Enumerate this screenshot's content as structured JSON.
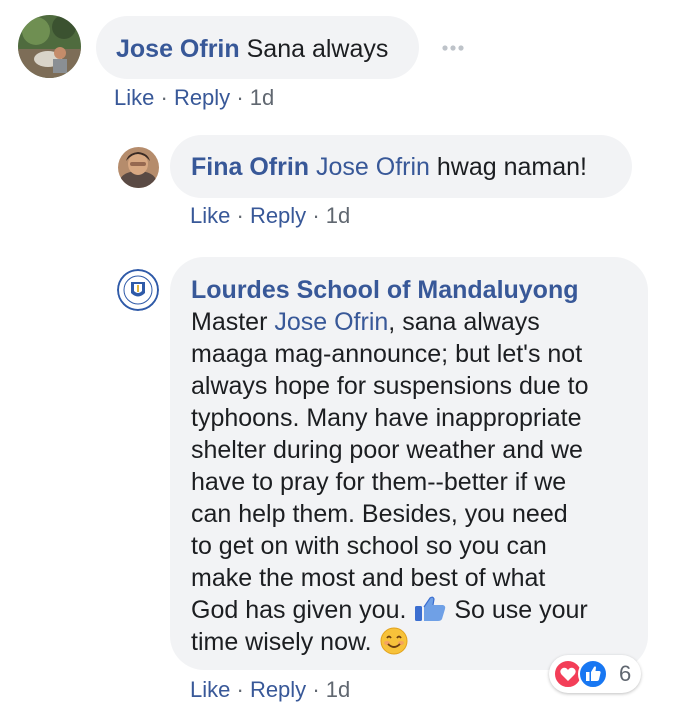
{
  "comments": [
    {
      "author": "Jose Ofrin",
      "text": "Sana always",
      "actions": {
        "like": "Like",
        "sep1": "·",
        "reply": "Reply",
        "sep2": "·",
        "time": "1d"
      }
    },
    {
      "author": "Fina Ofrin",
      "mention": "Jose Ofrin",
      "text": " hwag naman!",
      "actions": {
        "like": "Like",
        "sep1": "·",
        "reply": "Reply",
        "sep2": "·",
        "time": "1d"
      }
    },
    {
      "author": "Lourdes School of Mandaluyong",
      "lines": {
        "l1_pre": "Master ",
        "l1_mention": "Jose Ofrin",
        "l1_post": ", sana always",
        "l2": "maaga mag-announce; but let's not",
        "l3": "always hope for suspensions due to",
        "l4": "typhoons. Many have inappropriate",
        "l5": "shelter during poor weather and we",
        "l6": "have to pray for them--better if we",
        "l7": "can help them. Besides, you need",
        "l8": "to get on with school so you can",
        "l9": "make the most and best of what",
        "l10_pre": "God has given you. ",
        "l10_post": " So use your",
        "l11": "time wisely now. "
      },
      "reactions": {
        "count": "6",
        "icons": [
          "heart-icon",
          "thumbs-up-icon"
        ]
      },
      "actions": {
        "like": "Like",
        "sep1": "·",
        "reply": "Reply",
        "sep2": "·",
        "time": "1d"
      }
    }
  ],
  "more_options_icon": "ellipsis-icon",
  "colors": {
    "link": "#385898",
    "bubble": "#f2f3f5",
    "meta": "#606770",
    "heart": "#f33e58",
    "like": "#1877f2"
  }
}
